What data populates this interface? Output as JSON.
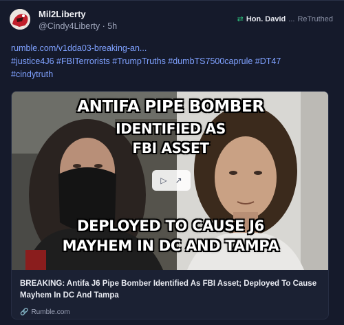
{
  "author": {
    "display_name": "Mil2Liberty",
    "handle": "@Cindy4Liberty",
    "separator": " · ",
    "time_ago": "5h"
  },
  "retruth": {
    "icon": "retruth-icon",
    "by": "Hon. David",
    "ellipsis": "...",
    "label": "ReTruthed"
  },
  "post": {
    "link": "rumble.com/v1dda03-breaking-an...",
    "hashtags_line1": "#justice4J6 #FBITerrorists #TrumpTruths #dumbTS7500caprule #DT47",
    "hashtags_line2": "#cindytruth"
  },
  "thumbnail": {
    "line1": "ANTIFA PIPE BOMBER",
    "line2": "IDENTIFIED AS",
    "line3": "FBI ASSET",
    "line4": "DEPLOYED TO CAUSE  J6",
    "line5": "MAYHEM IN DC AND TAMPA"
  },
  "card": {
    "title": "BREAKING: Antifa J6 Pipe Bomber Identified As FBI Asset; Deployed To Cause Mayhem In DC And Tampa",
    "domain": "Rumble.com"
  },
  "colors": {
    "background": "#151a2b",
    "link": "#7fa1ff",
    "retruth_green": "#2ec27e"
  }
}
